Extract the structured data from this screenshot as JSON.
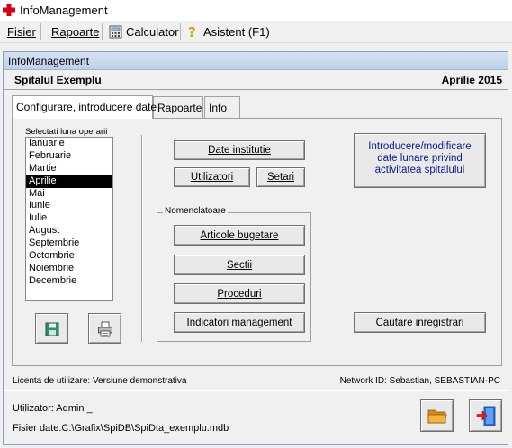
{
  "window": {
    "title": "InfoManagement"
  },
  "menu": [
    {
      "label": "Fisier"
    },
    {
      "label": "Rapoarte"
    },
    {
      "label": "Calculator"
    },
    {
      "label": "Asistent (F1)"
    }
  ],
  "inner_window": {
    "title": "InfoManagement"
  },
  "header": {
    "hospital": "Spitalul Exemplu",
    "period": "Aprilie 2015"
  },
  "tabs": [
    {
      "label": "Configurare, introducere date",
      "active": true
    },
    {
      "label": "Rapoarte",
      "active": false
    },
    {
      "label": "Info",
      "active": false
    }
  ],
  "months_label": "Selectati luna operarii",
  "months": [
    "Ianuarie",
    "Februarie",
    "Martie",
    "Aprilie",
    "Mai",
    "Iunie",
    "Iulie",
    "August",
    "Septembrie",
    "Octombrie",
    "Noiembrie",
    "Decembrie"
  ],
  "selected_month": "Aprilie",
  "buttons": {
    "date_institutie": "Date institutie",
    "utilizatori": "Utilizatori",
    "setari": "Setari",
    "introducere": "Introducere/modificare date lunare privind activitatea spitalului",
    "articole": "Articole bugetare",
    "sectii": "Sectii",
    "proceduri": "Proceduri",
    "indicatori": "Indicatori management",
    "cautare": "Cautare inregistrari"
  },
  "nomenclatoare_label": "Nomenclatoare",
  "footer": {
    "license": "Licenta de utilizare: Versiune demonstrativa",
    "network": "Network ID: Sebastian, SEBASTIAN-PC",
    "user": "Utilizator: Admin _",
    "db_file": "Fisier date:C:\\Grafix\\SpiDB\\SpiDta_exemplu.mdb"
  },
  "colors": {
    "accent_red": "#d0021b",
    "title_blue": "#bdd0ea",
    "selection": "#000000"
  }
}
